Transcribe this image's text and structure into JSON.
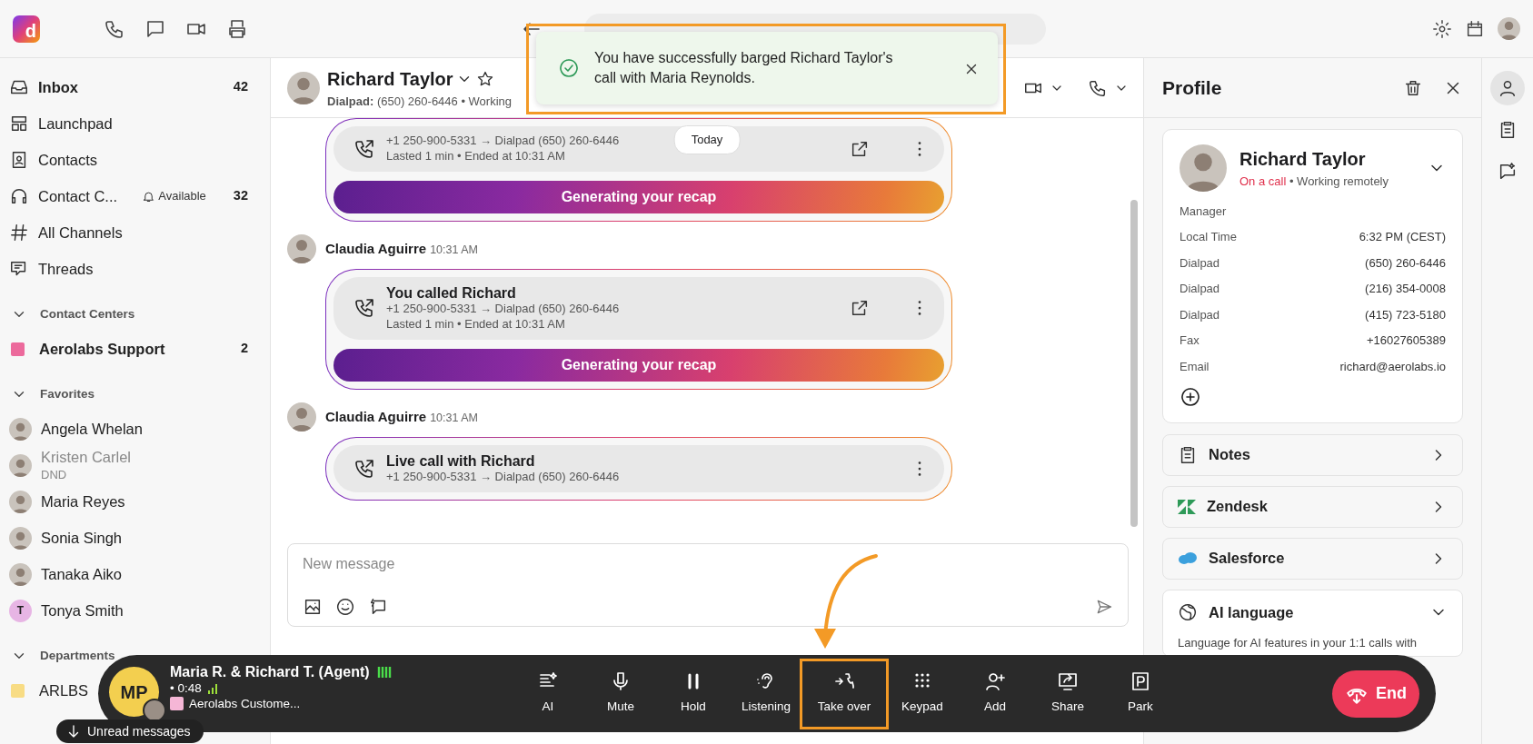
{
  "logo": {
    "letter": "d"
  },
  "sidebar": {
    "nav": [
      {
        "label": "Inbox",
        "count": "42",
        "unread": true
      },
      {
        "label": "Launchpad",
        "unread": false
      },
      {
        "label": "Contacts",
        "unread": false
      },
      {
        "label": "Contact C...",
        "status": "Available",
        "count": "32",
        "unread": false
      },
      {
        "label": "All Channels",
        "unread": false
      },
      {
        "label": "Threads",
        "unread": false
      }
    ],
    "sections": [
      {
        "title": "Contact Centers",
        "expanded": true,
        "items": [
          {
            "kind": "team",
            "label": "Aerolabs Support",
            "count": "2",
            "unread": true,
            "color": "#ec6a9c"
          }
        ]
      },
      {
        "title": "Favorites",
        "expanded": true,
        "items": [
          {
            "kind": "person",
            "label": "Angela Whelan",
            "dimmed": false
          },
          {
            "kind": "person",
            "label": "Kristen Carlel",
            "status": "DND",
            "dimmed": true
          },
          {
            "kind": "person",
            "label": "Maria Reyes",
            "dimmed": false
          },
          {
            "kind": "person",
            "label": "Sonia Singh",
            "dimmed": false
          },
          {
            "kind": "person",
            "label": "Tanaka Aiko",
            "dimmed": false
          },
          {
            "kind": "initial",
            "initial": "T",
            "label": "Tonya Smith",
            "dimmed": false
          }
        ]
      },
      {
        "title": "Departments",
        "expanded": true,
        "items": [
          {
            "kind": "team",
            "label": "ARLBS",
            "unread": false,
            "color": "#f8dc84"
          }
        ]
      }
    ]
  },
  "unread_pill": "Unread messages",
  "conversation": {
    "name": "Richard Taylor",
    "subtitle": "**Dialpad:** (650) 260-6446 • Working",
    "date_divider": "Today",
    "messages": [
      {
        "card": {
          "route": "+1 250-900-5331 → Dialpad (650) 260-6446",
          "details": "Lasted 1 min • Ended at 10:31 AM",
          "can_open": true,
          "recap": "Generating your recap"
        }
      },
      {
        "sender": "Claudia Aguirre",
        "time": "10:31 AM",
        "card": {
          "title": "You called Richard",
          "route": "+1 250-900-5331 → Dialpad (650) 260-6446",
          "details": "Lasted 1 min • Ended at 10:31 AM",
          "can_open": true,
          "recap": "Generating your recap"
        }
      },
      {
        "sender": "Claudia Aguirre",
        "time": "10:31 AM",
        "card": {
          "title": "Live call with Richard",
          "route": "+1 250-900-5331 → Dialpad (650) 260-6446",
          "can_open": false
        }
      }
    ],
    "composer": {
      "placeholder": "New message"
    }
  },
  "toast": {
    "kind": "success",
    "message": "You have successfully barged Richard Taylor's call with Maria Reynolds.",
    "annotated": true
  },
  "profile": {
    "title": "Profile",
    "contact": {
      "name": "Richard Taylor",
      "status": "On a call",
      "note": "• Working remotely",
      "role": "Manager",
      "fields": [
        {
          "label": "Local Time",
          "value": "6:32 PM (CEST)"
        },
        {
          "label": "Dialpad",
          "value": "(650) 260-6446"
        },
        {
          "label": "Dialpad",
          "value": "(216) 354-0008"
        },
        {
          "label": "Dialpad",
          "value": "(415) 723-5180"
        },
        {
          "label": "Fax",
          "value": "+16027605389"
        },
        {
          "label": "Email",
          "value": "richard@aerolabs.io"
        }
      ]
    },
    "sections": [
      {
        "kind": "notes",
        "title": "Notes",
        "expanded": false
      },
      {
        "kind": "zendesk",
        "title": "Zendesk",
        "expanded": false
      },
      {
        "kind": "salesforce",
        "title": "Salesforce",
        "expanded": false
      },
      {
        "kind": "language",
        "title": "AI language",
        "expanded": true,
        "description": "Language for AI features in your 1:1 calls with"
      }
    ]
  },
  "rail": [
    {
      "kind": "person",
      "selected": true
    },
    {
      "kind": "clipboard",
      "selected": false
    },
    {
      "kind": "chat",
      "selected": false
    }
  ],
  "call_bar": {
    "initials": "MP",
    "title": "Maria R. & Richard T. (Agent)",
    "timer": "• 0:48",
    "queue": {
      "label": "Aerolabs Custome...",
      "color": "#f5b6d6"
    },
    "controls": [
      {
        "kind": "ai",
        "label": "AI",
        "annotated": false
      },
      {
        "kind": "mute",
        "label": "Mute",
        "annotated": false
      },
      {
        "kind": "hold",
        "label": "Hold",
        "annotated": false
      },
      {
        "kind": "listening",
        "label": "Listening",
        "annotated": false
      },
      {
        "kind": "takeover",
        "label": "Take over",
        "annotated": true
      },
      {
        "kind": "keypad",
        "label": "Keypad",
        "annotated": false
      },
      {
        "kind": "add",
        "label": "Add",
        "annotated": false
      },
      {
        "kind": "share",
        "label": "Share",
        "annotated": false
      },
      {
        "kind": "park",
        "label": "Park",
        "annotated": false
      }
    ],
    "end": "End"
  }
}
